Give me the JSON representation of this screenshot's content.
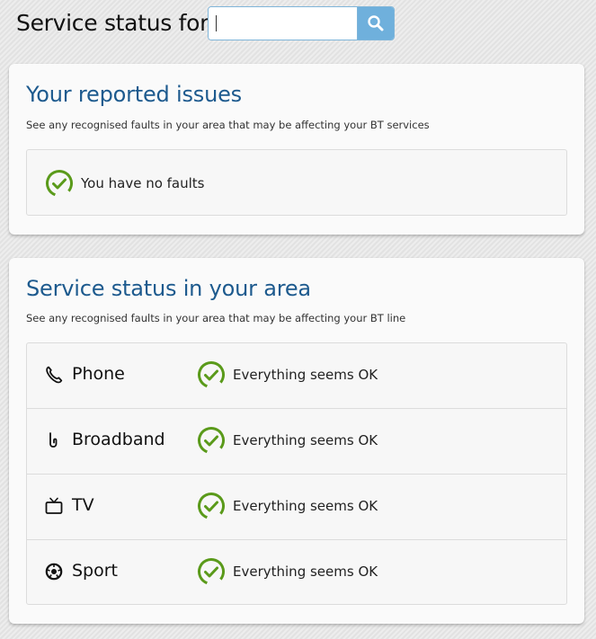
{
  "search": {
    "label": "Service status for",
    "placeholder": "",
    "value": "",
    "icon": "search-icon"
  },
  "issues": {
    "title": "Your reported issues",
    "subtitle": "See any recognised faults in your area that may be affecting your BT services",
    "status_text": "You have no faults",
    "status_icon": "check-circle-icon"
  },
  "area": {
    "title": "Service status in your area",
    "subtitle": "See any recognised faults in your area that may be affecting your BT line",
    "services": [
      {
        "name": "Phone",
        "icon": "phone-icon",
        "status": "Everything seems OK"
      },
      {
        "name": "Broadband",
        "icon": "broadband-icon",
        "status": "Everything seems OK"
      },
      {
        "name": "TV",
        "icon": "tv-icon",
        "status": "Everything seems OK"
      },
      {
        "name": "Sport",
        "icon": "sport-icon",
        "status": "Everything seems OK"
      }
    ]
  },
  "colors": {
    "heading_blue": "#1d5a8e",
    "ok_green": "#5a9a1a",
    "search_button": "#6fb0dc"
  }
}
